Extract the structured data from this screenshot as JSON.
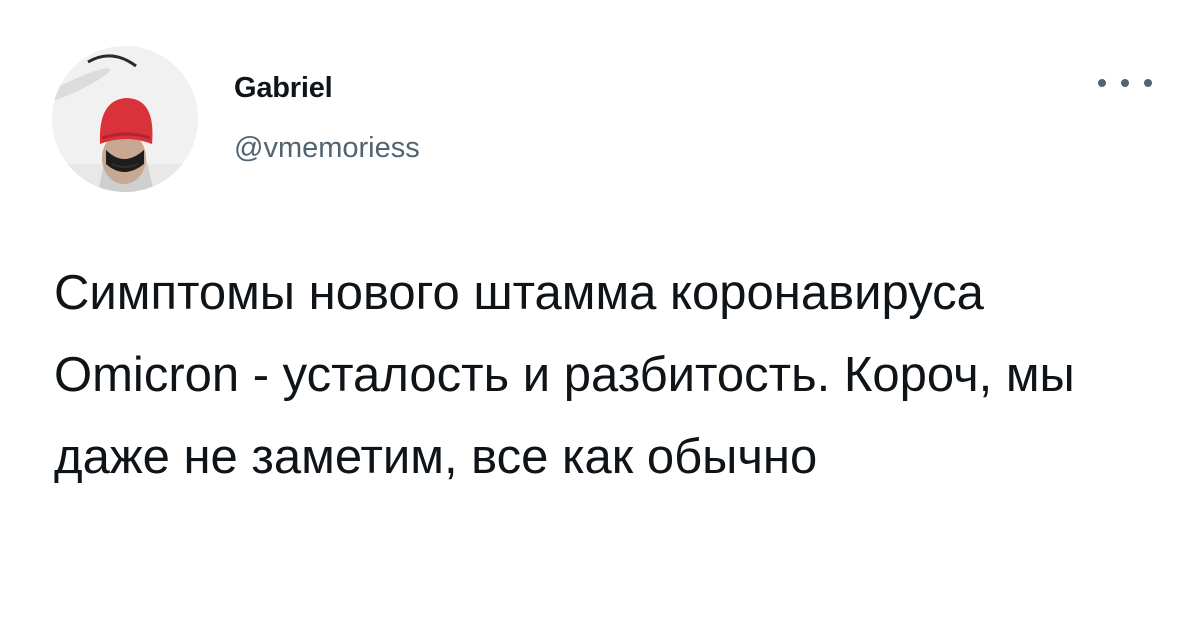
{
  "author": {
    "display_name": "Gabriel",
    "handle": "@vmemoriess"
  },
  "menu": {
    "icon": "more-horizontal-icon"
  },
  "tweet": {
    "text": "Симптомы нового штамма коронавируса Omicron - усталость и разбитость. Короч, мы даже не заметим, все как обычно"
  },
  "colors": {
    "text": "#0f1419",
    "secondary": "#536471",
    "background": "#ffffff",
    "hat": "#d9323a"
  }
}
